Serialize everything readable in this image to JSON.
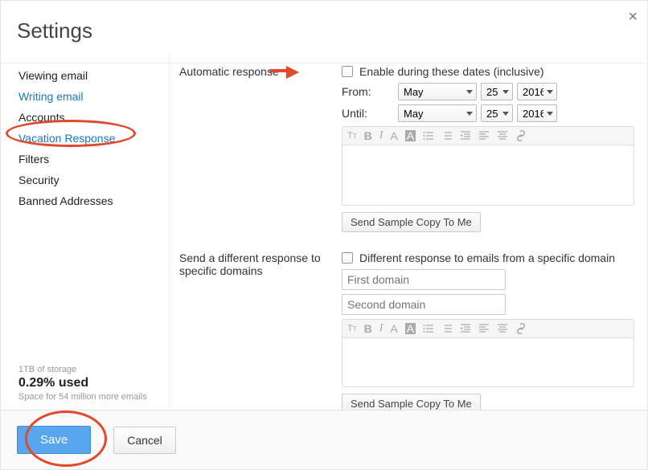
{
  "title": "Settings",
  "nav": {
    "items": [
      {
        "label": "Viewing email"
      },
      {
        "label": "Writing email"
      },
      {
        "label": "Accounts"
      },
      {
        "label": "Vacation Response"
      },
      {
        "label": "Filters"
      },
      {
        "label": "Security"
      },
      {
        "label": "Banned Addresses"
      }
    ]
  },
  "storage": {
    "line1": "1TB of storage",
    "line2": "0.29% used",
    "line3": "Space for 54 million more emails"
  },
  "auto": {
    "heading": "Automatic response",
    "enable_label": "Enable during these dates (inclusive)",
    "from_label": "From:",
    "until_label": "Until:",
    "month": "May",
    "day": "25",
    "year": "2016",
    "send_sample": "Send Sample Copy To Me"
  },
  "domain": {
    "heading": "Send a different response to specific domains",
    "enable_label": "Different response to emails from a specific domain",
    "first_placeholder": "First domain",
    "second_placeholder": "Second domain",
    "send_sample": "Send Sample Copy To Me"
  },
  "footer": {
    "save": "Save",
    "cancel": "Cancel"
  }
}
